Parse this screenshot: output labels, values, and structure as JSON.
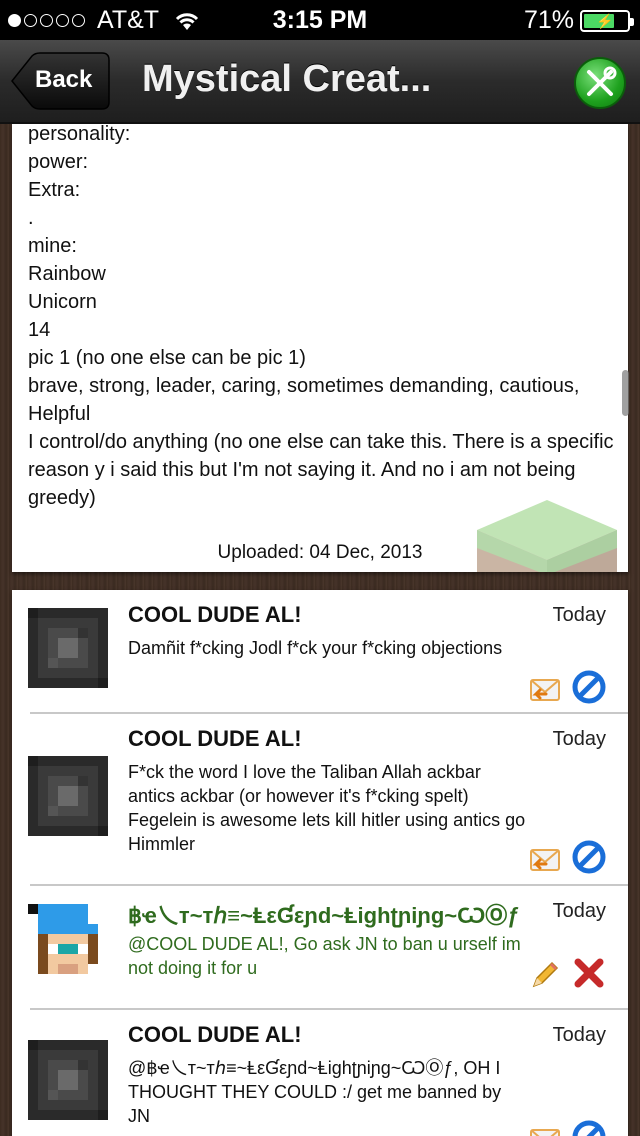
{
  "status_bar": {
    "carrier": "AT&T",
    "signal_bars": 1,
    "time": "3:15 PM",
    "battery": "71%",
    "battery_level": 0.71
  },
  "nav": {
    "back_label": "Back",
    "title": "Mystical Creat..."
  },
  "post": {
    "lines": [
      "personality:",
      "power:",
      "Extra:",
      ".",
      "mine:",
      "Rainbow",
      "Unicorn",
      "14",
      "pic 1 (no one else can be pic 1)",
      "brave, strong, leader, caring, sometimes demanding, cautious, Helpful",
      "I control/do anything (no one else can take this. There is a specific reason y i said this but I'm not saying it. And no i am not being greedy)"
    ],
    "uploaded": "Uploaded: 04 Dec, 2013"
  },
  "comments": [
    {
      "author": "COOL DUDE AL!",
      "date": "Today",
      "text": "Damñit f*cking Jodl f*ck your f*cking objections",
      "actions": [
        "reply-icon",
        "block-icon"
      ]
    },
    {
      "author": "COOL DUDE AL!",
      "date": "Today",
      "text": "F*ck the word I love the Taliban Allah ackbar antics ackbar (or however it's f*cking spelt) Fegelein is awesome lets kill hitler using antics go Himmler",
      "actions": [
        "reply-icon",
        "block-icon"
      ]
    },
    {
      "author": "฿ҽ乀т~тℎ≡~ⱠεƓεɲd~Ⱡighʈɲiɲg~ѠⓄƒ",
      "date": "Today",
      "text": "@COOL DUDE AL!, Go ask JN to ban u urself im not doing it for u",
      "actions": [
        "edit-icon",
        "delete-icon"
      ],
      "color": "#2f6b1e"
    },
    {
      "author": "COOL DUDE AL!",
      "date": "Today",
      "text": "@฿ҽ乀т~тℎ≡~ⱠεƓεɲd~Ⱡighʈɲiɲg~ѠⓄƒ, OH I THOUGHT THEY COULD :/ get me banned by JN",
      "actions": [
        "reply-icon",
        "block-icon"
      ]
    }
  ]
}
